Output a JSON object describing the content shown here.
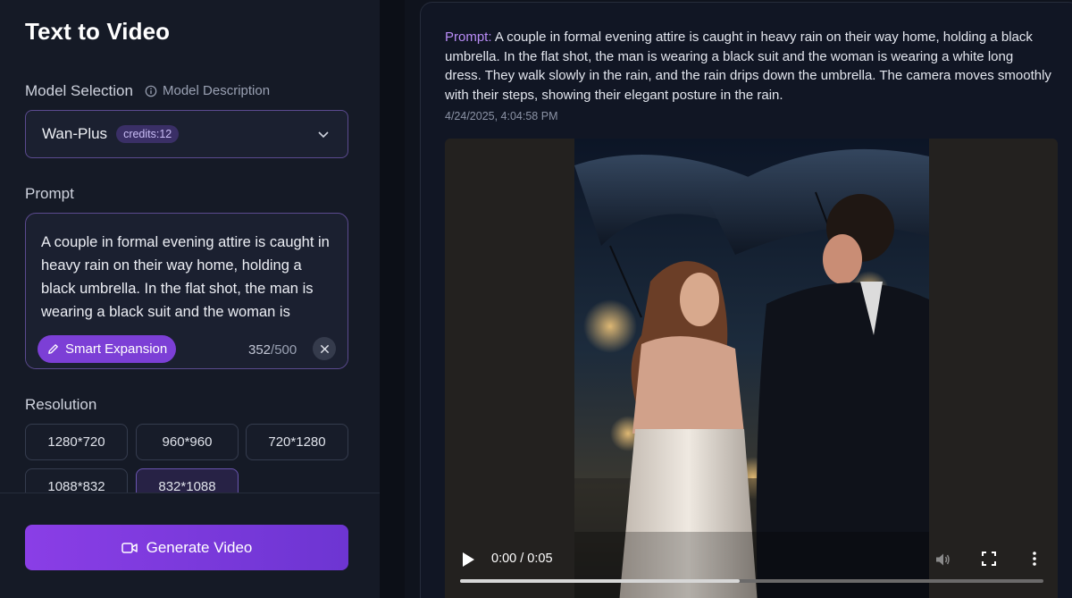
{
  "left_panel": {
    "title": "Text to Video",
    "model_selection_label": "Model Selection",
    "model_description_link": "Model Description",
    "model_select": {
      "value": "Wan-Plus",
      "credits": "credits:12"
    },
    "prompt_label": "Prompt",
    "prompt_text": "A couple in formal evening attire is caught in heavy rain on their way home, holding a black umbrella. In the flat shot, the man is wearing a black suit and the woman is wearing a white long dress. They walk slowly in the rain, and the rain drips down the umbrella. The camera moves smoothly with their steps, showing their elegant posture in the rain.",
    "smart_expansion_label": "Smart Expansion",
    "char_count": "352",
    "char_limit": "/500",
    "resolution_label": "Resolution",
    "resolutions": [
      "1280*720",
      "960*960",
      "720*1280",
      "1088*832",
      "832*1088"
    ],
    "selected_resolution": "832*1088",
    "generate_button": "Generate Video"
  },
  "result": {
    "prompt_key": "Prompt:",
    "prompt_value": "A couple in formal evening attire is caught in heavy rain on their way home, holding a black umbrella. In the flat shot, the man is wearing a black suit and the woman is wearing a white long dress. They walk slowly in the rain, and the rain drips down the umbrella. The camera moves smoothly with their steps, showing their elegant posture in the rain.",
    "timestamp": "4/24/2025, 4:04:58 PM",
    "video": {
      "time_display": "0:00 / 0:05",
      "progress": 0.48
    }
  },
  "icons": {
    "info": "info-icon",
    "chevron": "chevron-down-icon",
    "pencil": "pencil-icon",
    "close": "close-icon",
    "video": "video-camera-icon",
    "play": "play-icon",
    "volume": "volume-icon",
    "fullscreen": "fullscreen-icon",
    "more": "more-vertical-icon"
  }
}
